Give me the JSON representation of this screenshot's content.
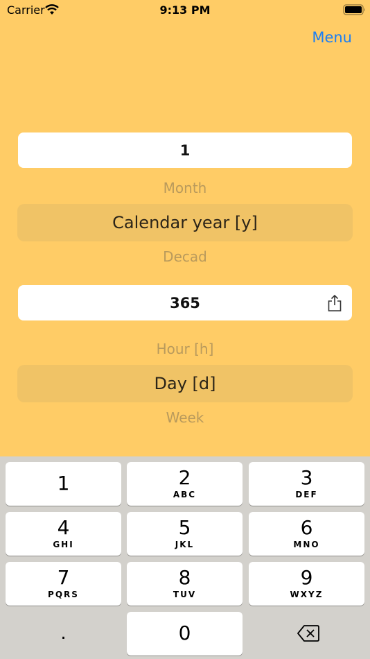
{
  "status_bar": {
    "carrier": "Carrier",
    "time": "9:13 PM"
  },
  "header": {
    "menu_label": "Menu"
  },
  "converter": {
    "input_value": "1",
    "from_picker": {
      "above": "Month",
      "selected": "Calendar year [y]",
      "below": "Decad"
    },
    "result_value": "365",
    "to_picker": {
      "above": "Hour  [h]",
      "selected": "Day  [d]",
      "below": "Week"
    }
  },
  "keyboard": {
    "keys": [
      {
        "digit": "1",
        "letters": ""
      },
      {
        "digit": "2",
        "letters": "ABC"
      },
      {
        "digit": "3",
        "letters": "DEF"
      },
      {
        "digit": "4",
        "letters": "GHI"
      },
      {
        "digit": "5",
        "letters": "JKL"
      },
      {
        "digit": "6",
        "letters": "MNO"
      },
      {
        "digit": "7",
        "letters": "PQRS"
      },
      {
        "digit": "8",
        "letters": "TUV"
      },
      {
        "digit": "9",
        "letters": "WXYZ"
      },
      {
        "digit": "0",
        "letters": ""
      }
    ],
    "decimal_label": "."
  },
  "colors": {
    "background": "#FFCC66",
    "accent": "#1a7ef5",
    "picker_highlight": "#f0c366"
  }
}
